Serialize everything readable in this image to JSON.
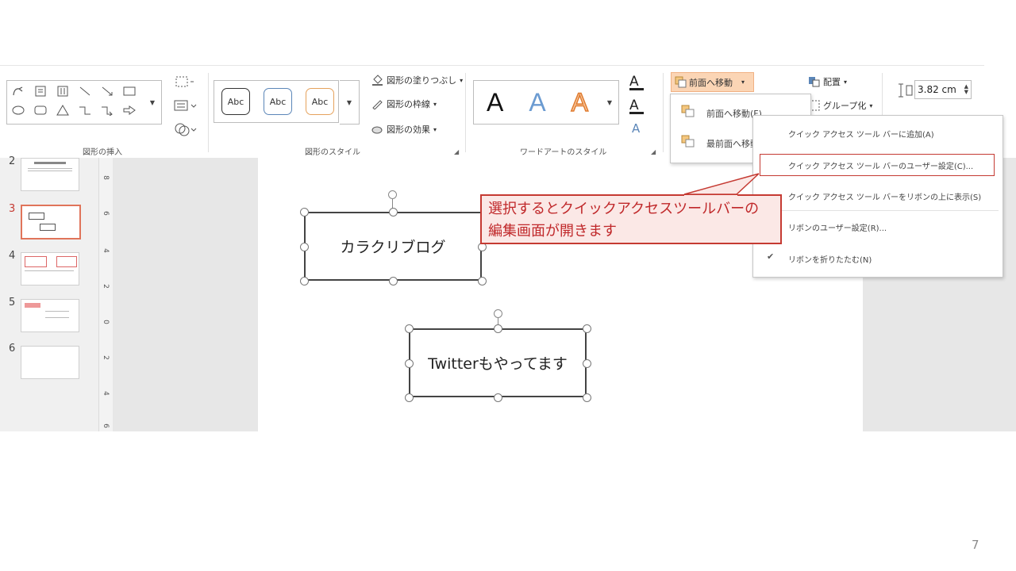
{
  "ribbon": {
    "groups": {
      "insert_shapes": "図形の挿入",
      "shape_styles": "図形のスタイル",
      "wordart_styles": "ワードアートのスタイル"
    },
    "style_samples": [
      "Abc",
      "Abc",
      "Abc"
    ],
    "shape_fill": "図形の塗りつぶし",
    "shape_outline": "図形の枠線",
    "shape_effects": "図形の効果",
    "wordart_letter": "A",
    "bring_forward": "前面へ移動",
    "arrange": "配置",
    "group": "グループ化",
    "height_value": "3.82 cm"
  },
  "bring_forward_menu": {
    "items": [
      "前面へ移動(F)",
      "最前面へ移動"
    ]
  },
  "context_menu": {
    "items": [
      "クイック アクセス ツール バーに追加(A)",
      "クイック アクセス ツール バーのユーザー設定(C)...",
      "クイック アクセス ツール バーをリボンの上に表示(S)",
      "リボンのユーザー設定(R)...",
      "リボンを折りたたむ(N)"
    ],
    "checked_mark": "✔"
  },
  "thumbnails": [
    "2",
    "3",
    "4",
    "5",
    "6"
  ],
  "ruler_marks": [
    "8",
    "6",
    "4",
    "2",
    "0",
    "2",
    "4",
    "6"
  ],
  "slide": {
    "shape1_text": "カラクリブログ",
    "shape2_text": "Twitterもやってます"
  },
  "callout": {
    "line1": "選択するとクイックアクセスツールバーの",
    "line2": "編集画面が開きます"
  },
  "page_number": "7",
  "colors": {
    "accent_red": "#c53a32",
    "callout_fill": "#fbe8e6",
    "highlight_orange": "#fbd5b5"
  }
}
